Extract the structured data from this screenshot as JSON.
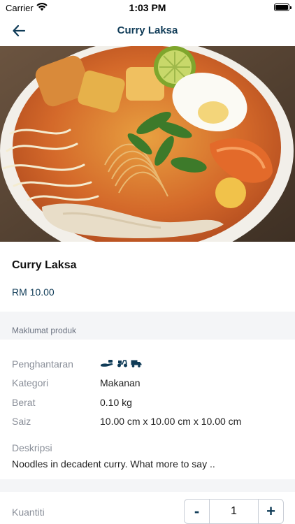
{
  "status_bar": {
    "carrier": "Carrier",
    "time": "1:03 PM",
    "wifi_icon": "wifi-icon",
    "battery_icon": "battery-icon"
  },
  "nav": {
    "title": "Curry Laksa",
    "back_icon": "back-arrow-icon"
  },
  "product": {
    "name": "Curry Laksa",
    "price": "RM 10.00",
    "image": "curry-laksa-photo"
  },
  "info_section": {
    "label": "Maklumat produk",
    "delivery_label": "Penghantaran",
    "delivery_icons": [
      "hand-pickup-icon",
      "scooter-icon",
      "truck-icon"
    ],
    "category_label": "Kategori",
    "category_value": "Makanan",
    "weight_label": "Berat",
    "weight_value": "0.10 kg",
    "size_label": "Saiz",
    "size_value": "10.00 cm x 10.00 cm x 10.00 cm",
    "description_label": "Deskripsi",
    "description_value": "Noodles in decadent curry. What more to say .."
  },
  "quantity": {
    "label": "Kuantiti",
    "value": "1",
    "minus": "-",
    "plus": "+"
  },
  "colors": {
    "accent": "#0f3b57",
    "muted": "#8a8f99",
    "section_bg": "#f4f5f7"
  }
}
